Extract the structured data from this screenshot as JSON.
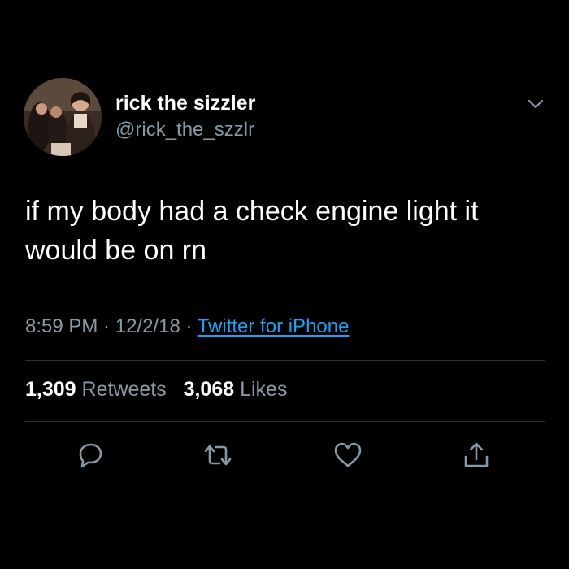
{
  "user": {
    "display_name": "rick the sizzler",
    "handle": "@rick_the_szzlr"
  },
  "tweet": {
    "text_line1": "if my body had a check engine light it",
    "text_line2": "would be on rn"
  },
  "meta": {
    "time": "8:59 PM",
    "sep1": " · ",
    "date": "12/2/18",
    "sep2": " · ",
    "source": "Twitter for iPhone"
  },
  "stats": {
    "retweets_count": "1,309",
    "retweets_label": "Retweets",
    "likes_count": "3,068",
    "likes_label": "Likes"
  },
  "icons": {
    "caret": "chevron-down-icon",
    "reply": "reply-icon",
    "retweet": "retweet-icon",
    "like": "heart-icon",
    "share": "share-icon"
  },
  "colors": {
    "background": "#000000",
    "text": "#ffffff",
    "secondary": "#8899a6",
    "link": "#1da1f2",
    "divider": "#2f3336"
  }
}
